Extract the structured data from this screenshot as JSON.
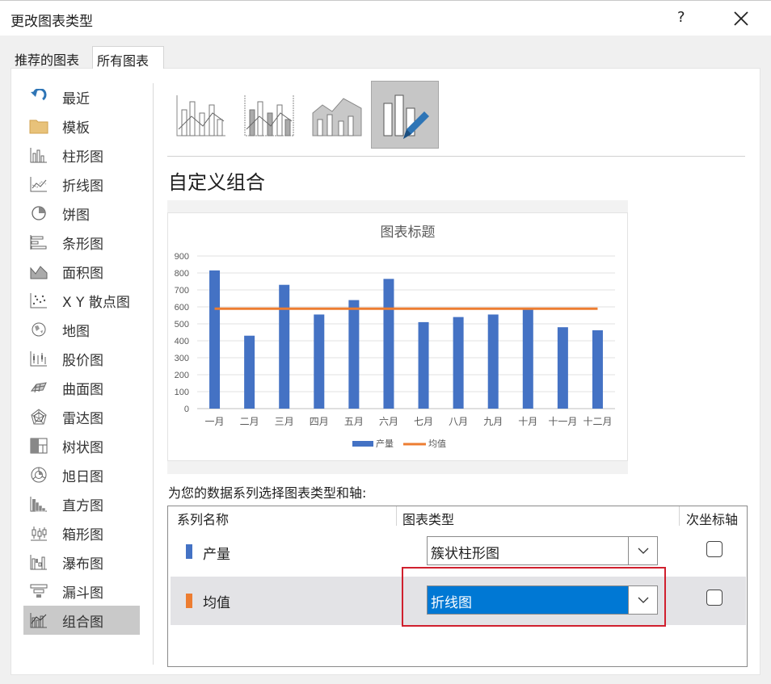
{
  "window": {
    "title": "更改图表类型",
    "help": "?"
  },
  "tabs": [
    {
      "label": "推荐的图表",
      "active": false
    },
    {
      "label": "所有图表",
      "active": true
    }
  ],
  "sidebar": {
    "items": [
      {
        "label": "最近",
        "icon": "recent-icon"
      },
      {
        "label": "模板",
        "icon": "folder-icon"
      },
      {
        "label": "柱形图",
        "icon": "column-chart-icon"
      },
      {
        "label": "折线图",
        "icon": "line-chart-icon"
      },
      {
        "label": "饼图",
        "icon": "pie-chart-icon"
      },
      {
        "label": "条形图",
        "icon": "bar-chart-icon"
      },
      {
        "label": "面积图",
        "icon": "area-chart-icon"
      },
      {
        "label": "X Y 散点图",
        "icon": "scatter-chart-icon"
      },
      {
        "label": "地图",
        "icon": "map-chart-icon"
      },
      {
        "label": "股价图",
        "icon": "stock-chart-icon"
      },
      {
        "label": "曲面图",
        "icon": "surface-chart-icon"
      },
      {
        "label": "雷达图",
        "icon": "radar-chart-icon"
      },
      {
        "label": "树状图",
        "icon": "treemap-chart-icon"
      },
      {
        "label": "旭日图",
        "icon": "sunburst-chart-icon"
      },
      {
        "label": "直方图",
        "icon": "histogram-chart-icon"
      },
      {
        "label": "箱形图",
        "icon": "box-whisker-chart-icon"
      },
      {
        "label": "瀑布图",
        "icon": "waterfall-chart-icon"
      },
      {
        "label": "漏斗图",
        "icon": "funnel-chart-icon"
      },
      {
        "label": "组合图",
        "icon": "combo-chart-icon"
      }
    ],
    "selected_index": 18
  },
  "subtypes": {
    "icons": [
      "clustered-column-line-icon",
      "clustered-column-line-secondary-icon",
      "stacked-area-column-icon",
      "custom-combination-icon"
    ],
    "selected_index": 3
  },
  "section_title": "自定义组合",
  "instruction": "为您的数据系列选择图表类型和轴:",
  "series_table": {
    "headers": {
      "name": "系列名称",
      "type": "图表类型",
      "secondary": "次坐标轴"
    },
    "rows": [
      {
        "name": "产量",
        "color": "#4472c4",
        "type": "簇状柱形图",
        "secondary_axis": false,
        "highlighted": false
      },
      {
        "name": "均值",
        "color": "#ed7d31",
        "type": "折线图",
        "secondary_axis": false,
        "highlighted": true
      }
    ]
  },
  "chart_data": {
    "type": "bar",
    "title": "图表标题",
    "categories": [
      "一月",
      "二月",
      "三月",
      "四月",
      "五月",
      "六月",
      "七月",
      "八月",
      "九月",
      "十月",
      "十一月",
      "十二月"
    ],
    "series": [
      {
        "name": "产量",
        "type": "bar",
        "color": "#4472c4",
        "values": [
          815,
          430,
          730,
          555,
          640,
          765,
          510,
          540,
          555,
          585,
          480,
          462
        ]
      },
      {
        "name": "均值",
        "type": "line",
        "color": "#ed7d31",
        "values": [
          589,
          589,
          589,
          589,
          589,
          589,
          589,
          589,
          589,
          589,
          589,
          589
        ]
      }
    ],
    "ylim": [
      0,
      900
    ],
    "yticks": [
      0,
      100,
      200,
      300,
      400,
      500,
      600,
      700,
      800,
      900
    ],
    "grid": true,
    "legend": "bottom"
  }
}
